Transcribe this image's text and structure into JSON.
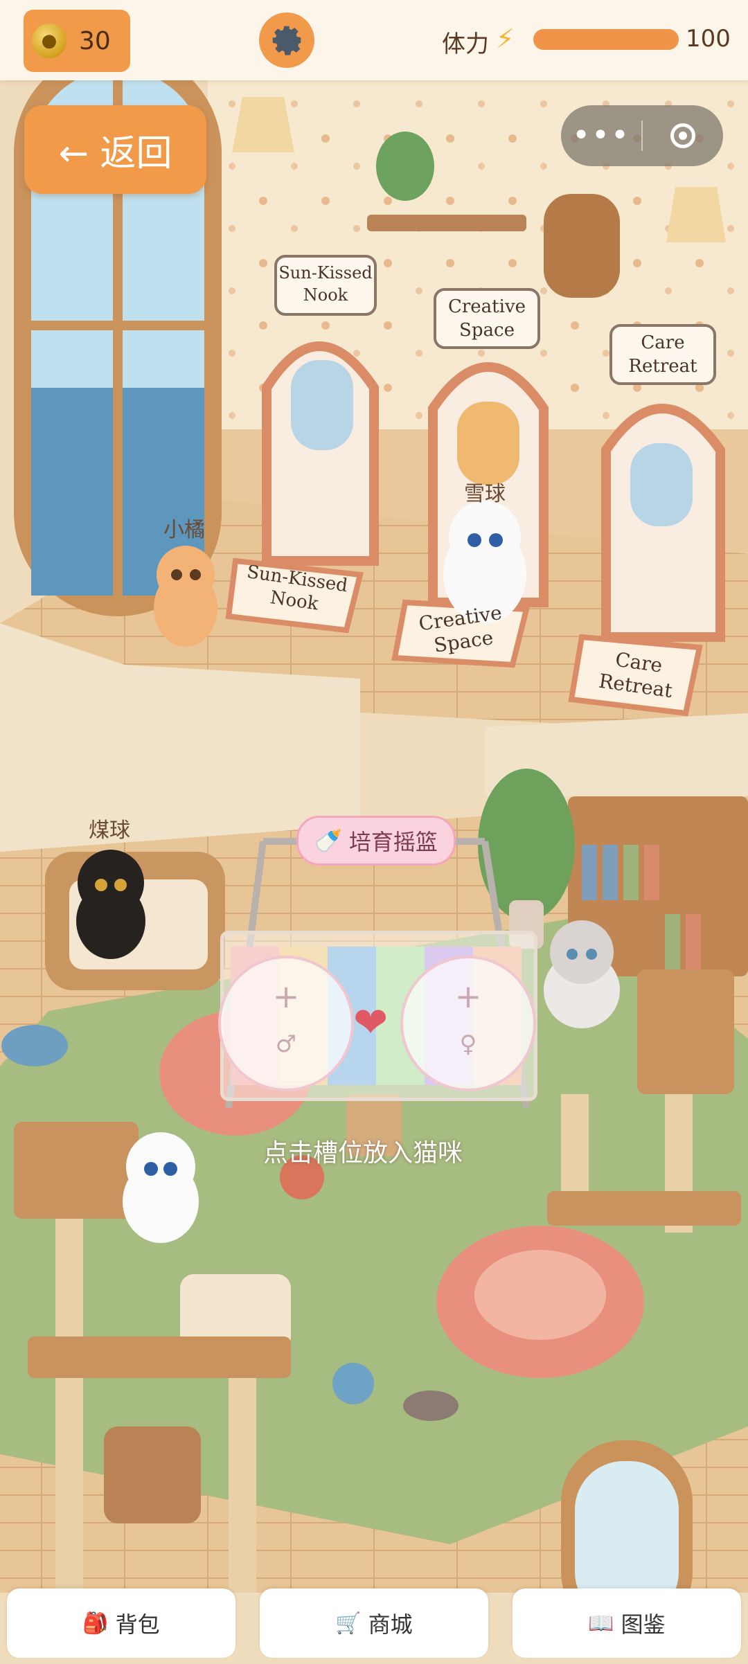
{
  "status_bar": {
    "coins": "30",
    "stamina_label": "体力",
    "stamina_value": "100",
    "stamina_fraction": 1.0
  },
  "back_button": {
    "label": "← 返回"
  },
  "room_signs": {
    "sun_kissed": "Sun-Kissed Nook",
    "creative": "Creative Space",
    "care": "Care Retreat"
  },
  "cats": [
    {
      "name": "小橘"
    },
    {
      "name": "雪球"
    },
    {
      "name": "煤球"
    }
  ],
  "cradle": {
    "tag_label": "培育摇篮",
    "male_symbol": "♂",
    "female_symbol": "♀",
    "plus": "+",
    "hint": "点击槽位放入猫咪"
  },
  "bottom_nav": {
    "bag": "背包",
    "shop": "商城",
    "collection": "图鉴"
  },
  "colors": {
    "accent": "#f19a4a",
    "heart": "#e05a66",
    "cradle_pink": "#fbd3df"
  }
}
